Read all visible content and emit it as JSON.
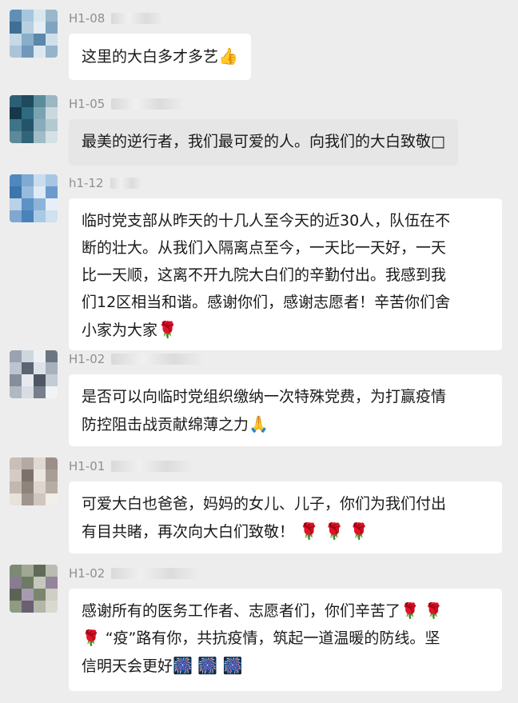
{
  "colors": {
    "background": "#ededed",
    "bubble": "#ffffff",
    "bubble_highlight": "#e6e6e6",
    "sender_text": "#8f8f8f",
    "message_text": "#1a1a1a"
  },
  "messages": [
    {
      "sender": "H1-08",
      "text": "这里的大白多才多艺",
      "emoji": "👍",
      "avatar_icon": "blurred-avatar-icon"
    },
    {
      "sender": "H1-05",
      "text": "最美的逆行者，我们最可爱的人。向我们的大白致敬",
      "emoji": "□",
      "avatar_icon": "blurred-avatar-icon"
    },
    {
      "sender": "h1-12",
      "text": "临时党支部从昨天的十几人至今天的近30人，队伍在不\n断的壮大。从我们入隔离点至今，一天比一天好，一天\n比一天顺，这离不开九院大白们的辛勤付出。我感到我\n们12区相当和谐。感谢你们，感谢志愿者！辛苦你们舍\n小家为大家",
      "emoji": "🌹",
      "avatar_icon": "blurred-avatar-icon"
    },
    {
      "sender": "H1-02",
      "text": "是否可以向临时党组织缴纳一次特殊党费，为打赢疫情\n防控阻击战贡献绵薄之力",
      "emoji": "🙏",
      "avatar_icon": "blurred-avatar-icon"
    },
    {
      "sender": "H1-01",
      "text": "可爱大白也爸爸，妈妈的女儿、儿子，你们为我们付出\n有目共睹，再次向大白们致敬！",
      "emoji": " 🌹 🌹 🌹",
      "avatar_icon": "blurred-avatar-icon"
    },
    {
      "sender": "H1-02",
      "text": "感谢所有的医务工作者、志愿者们，你们辛苦了🌹 🌹\n🌹 “疫”路有你，共抗疫情，筑起一道温暖的防线。坚\n信明天会更好",
      "emoji": "🎆 🎆 🎆",
      "avatar_icon": "blurred-avatar-icon"
    }
  ]
}
